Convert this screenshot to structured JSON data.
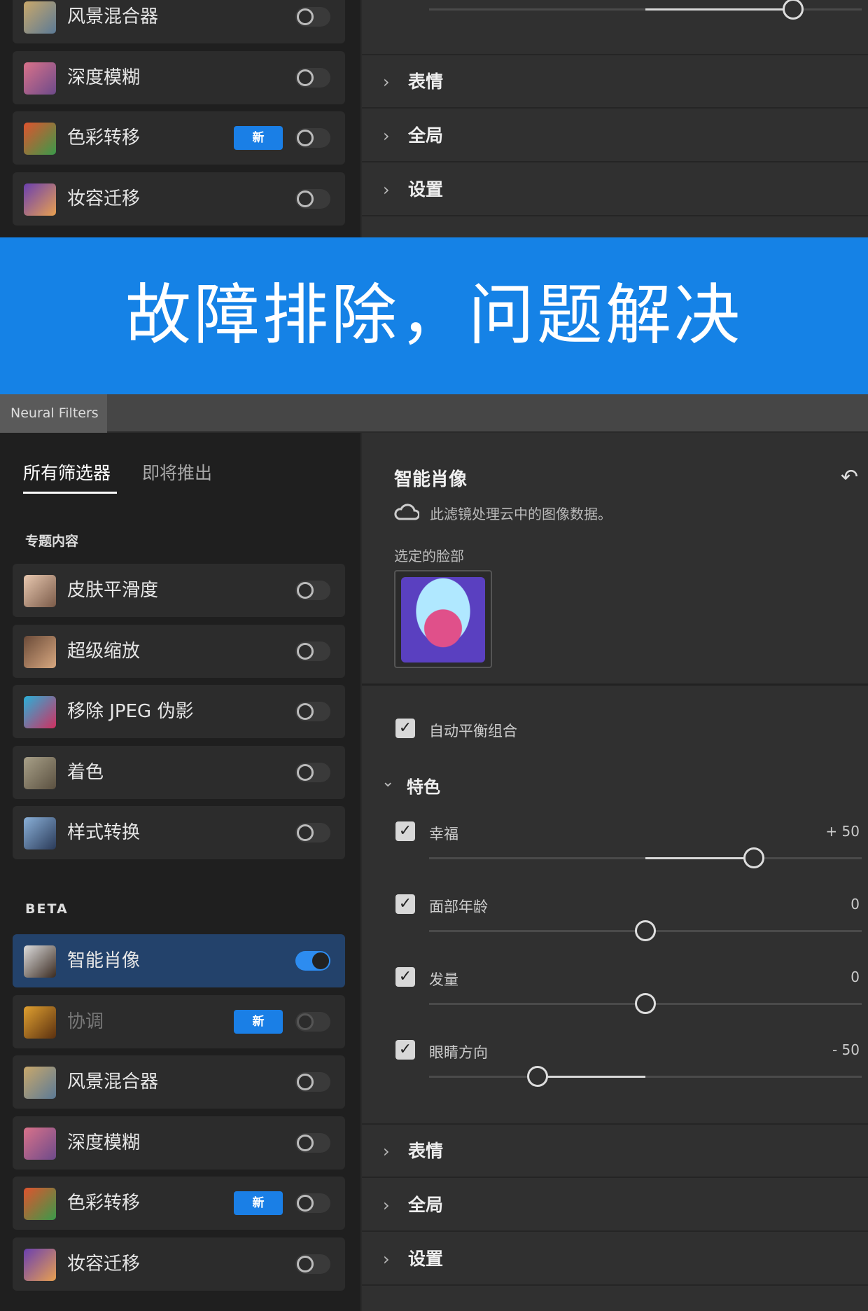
{
  "banner": {
    "text": "故障排除，问题解决",
    "color": "#1582E6"
  },
  "top_crop": {
    "items": [
      {
        "label": "风景混合器",
        "new": false,
        "on": false,
        "thumb": [
          "#c9a86b",
          "#5b7a96"
        ]
      },
      {
        "label": "深度模糊",
        "new": false,
        "on": false,
        "thumb": [
          "#d9728a",
          "#6d4a8a"
        ]
      },
      {
        "label": "色彩转移",
        "new": true,
        "on": false,
        "thumb": [
          "#e0532e",
          "#3a9a4a"
        ]
      },
      {
        "label": "妆容迁移",
        "new": false,
        "on": false,
        "thumb": [
          "#6a3fb0",
          "#e8a050"
        ]
      }
    ],
    "slider_value": 50,
    "sections": [
      "表情",
      "全局",
      "设置"
    ]
  },
  "panel": {
    "tab": "Neural Filters",
    "filter_tabs": [
      "所有筛选器",
      "即将推出"
    ],
    "featured_heading": "专题内容",
    "featured": [
      {
        "label": "皮肤平滑度",
        "new": false,
        "on": false,
        "thumb": [
          "#e8c8b0",
          "#7a5a48"
        ]
      },
      {
        "label": "超级缩放",
        "new": false,
        "on": false,
        "thumb": [
          "#6a4a38",
          "#d8a880"
        ]
      },
      {
        "label": "移除 JPEG 伪影",
        "new": false,
        "on": false,
        "thumb": [
          "#2ab0d8",
          "#d03060"
        ]
      },
      {
        "label": "着色",
        "new": false,
        "on": false,
        "thumb": [
          "#a8a088",
          "#5a5040"
        ]
      },
      {
        "label": "样式转换",
        "new": false,
        "on": false,
        "thumb": [
          "#8ab0d8",
          "#2a3a58"
        ]
      }
    ],
    "beta_heading": "BETA",
    "beta": [
      {
        "label": "智能肖像",
        "new": false,
        "on": true,
        "selected": true,
        "thumb": [
          "#ddd",
          "#3a2a20"
        ]
      },
      {
        "label": "协调",
        "new": true,
        "on": false,
        "disabled": true,
        "thumb": [
          "#e0a030",
          "#5a3010"
        ]
      },
      {
        "label": "风景混合器",
        "new": false,
        "on": false,
        "thumb": [
          "#c9a86b",
          "#5b7a96"
        ]
      },
      {
        "label": "深度模糊",
        "new": false,
        "on": false,
        "thumb": [
          "#d9728a",
          "#6d4a8a"
        ]
      },
      {
        "label": "色彩转移",
        "new": true,
        "on": false,
        "thumb": [
          "#e0532e",
          "#3a9a4a"
        ]
      },
      {
        "label": "妆容迁移",
        "new": false,
        "on": false,
        "thumb": [
          "#6a3fb0",
          "#e8a050"
        ]
      }
    ],
    "new_badge": "新",
    "detail": {
      "title": "智能肖像",
      "cloud_note": "此滤镜处理云中的图像数据。",
      "faces_label": "选定的脸部",
      "auto_balance": "自动平衡组合",
      "features_heading": "特色",
      "sliders": [
        {
          "label": "幸福",
          "value": 50,
          "display": "+ 50"
        },
        {
          "label": "面部年龄",
          "value": 0,
          "display": "0"
        },
        {
          "label": "发量",
          "value": 0,
          "display": "0"
        },
        {
          "label": "眼睛方向",
          "value": -50,
          "display": "- 50"
        }
      ],
      "sections": [
        "表情",
        "全局",
        "设置"
      ]
    }
  }
}
